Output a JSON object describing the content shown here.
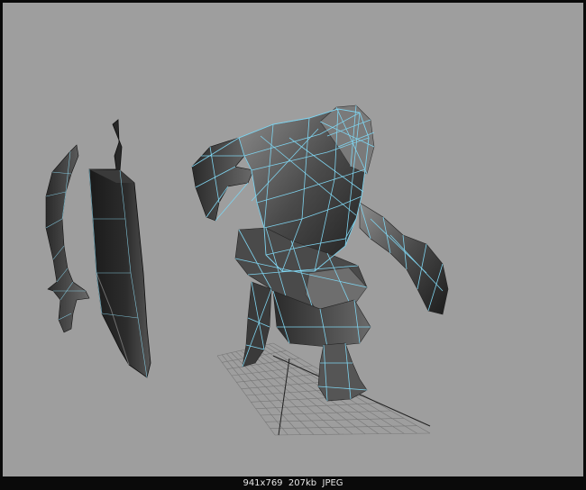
{
  "image_info": {
    "dimensions": "941x769",
    "size": "207kb",
    "format": "JPEG"
  },
  "colors": {
    "viewport_bg": "#9e9e9e",
    "frame": "#0a0a0a",
    "wireframe": "#7fd3ee",
    "mesh_dark": "#1e1e1e",
    "mesh_light": "#8a8a8a",
    "grid": "#6f6f6f"
  },
  "objects": [
    {
      "name": "character-mesh"
    },
    {
      "name": "sword-mesh"
    },
    {
      "name": "shield-mesh"
    },
    {
      "name": "ground-grid"
    }
  ]
}
